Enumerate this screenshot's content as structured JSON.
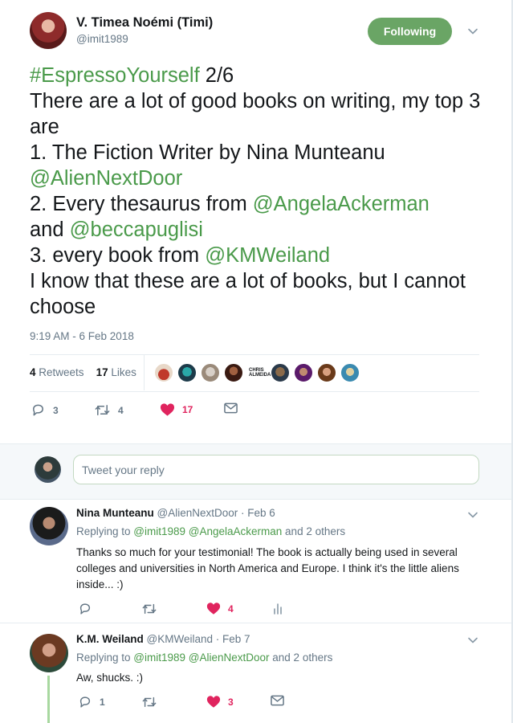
{
  "main_tweet": {
    "author_name": "V. Timea Noémi (Timi)",
    "author_handle": "@imit1989",
    "follow_label": "Following",
    "text_parts": {
      "hashtag": "#EspressoYourself",
      "line1_rest": " 2/6",
      "line2": "There are a lot of good books on writing, my top 3 are",
      "line3": "1. The Fiction Writer by Nina Munteanu",
      "mention1": "@AlienNextDoor",
      "line4_pre": "2. Every thesaurus from ",
      "mention2": "@AngelaAckerman",
      "and_word": "and ",
      "mention3": "@beccapuglisi",
      "line5_pre": "3. every book from ",
      "mention4": "@KMWeiland",
      "line6": "I know that these are a lot of books, but I cannot choose"
    },
    "timestamp": "9:19 AM - 6 Feb 2018",
    "retweets_count": "4",
    "retweets_label": "Retweets",
    "likes_count": "17",
    "likes_label": "Likes",
    "liker_text": "CHRIS ALMEIDA",
    "actions": {
      "reply_count": "3",
      "retweet_count": "4",
      "like_count": "17"
    },
    "colors": {
      "accent": "#4a9a4a",
      "follow_bg": "#6aa565",
      "like": "#e0245e"
    }
  },
  "reply_box": {
    "placeholder": "Tweet your reply"
  },
  "replies": [
    {
      "name": "Nina Munteanu",
      "handle": "@AlienNextDoor",
      "date": " · Feb 6",
      "replying_label": "Replying to ",
      "replying_mentions": "@imit1989 @AngelaAckerman",
      "replying_rest": " and 2 others",
      "text": "Thanks so much for your testimonial! The book is actually being used in several colleges and universities in North America and Europe. I think it's the little aliens inside... :)",
      "reply_count": "",
      "retweet_count": "",
      "like_count": "4"
    },
    {
      "name": "K.M. Weiland",
      "handle": "@KMWeiland",
      "date": " · Feb 7",
      "replying_label": "Replying to ",
      "replying_mentions": "@imit1989 @AlienNextDoor",
      "replying_rest": " and 2 others",
      "text": "Aw, shucks. :)",
      "reply_count": "1",
      "retweet_count": "",
      "like_count": "3"
    }
  ]
}
